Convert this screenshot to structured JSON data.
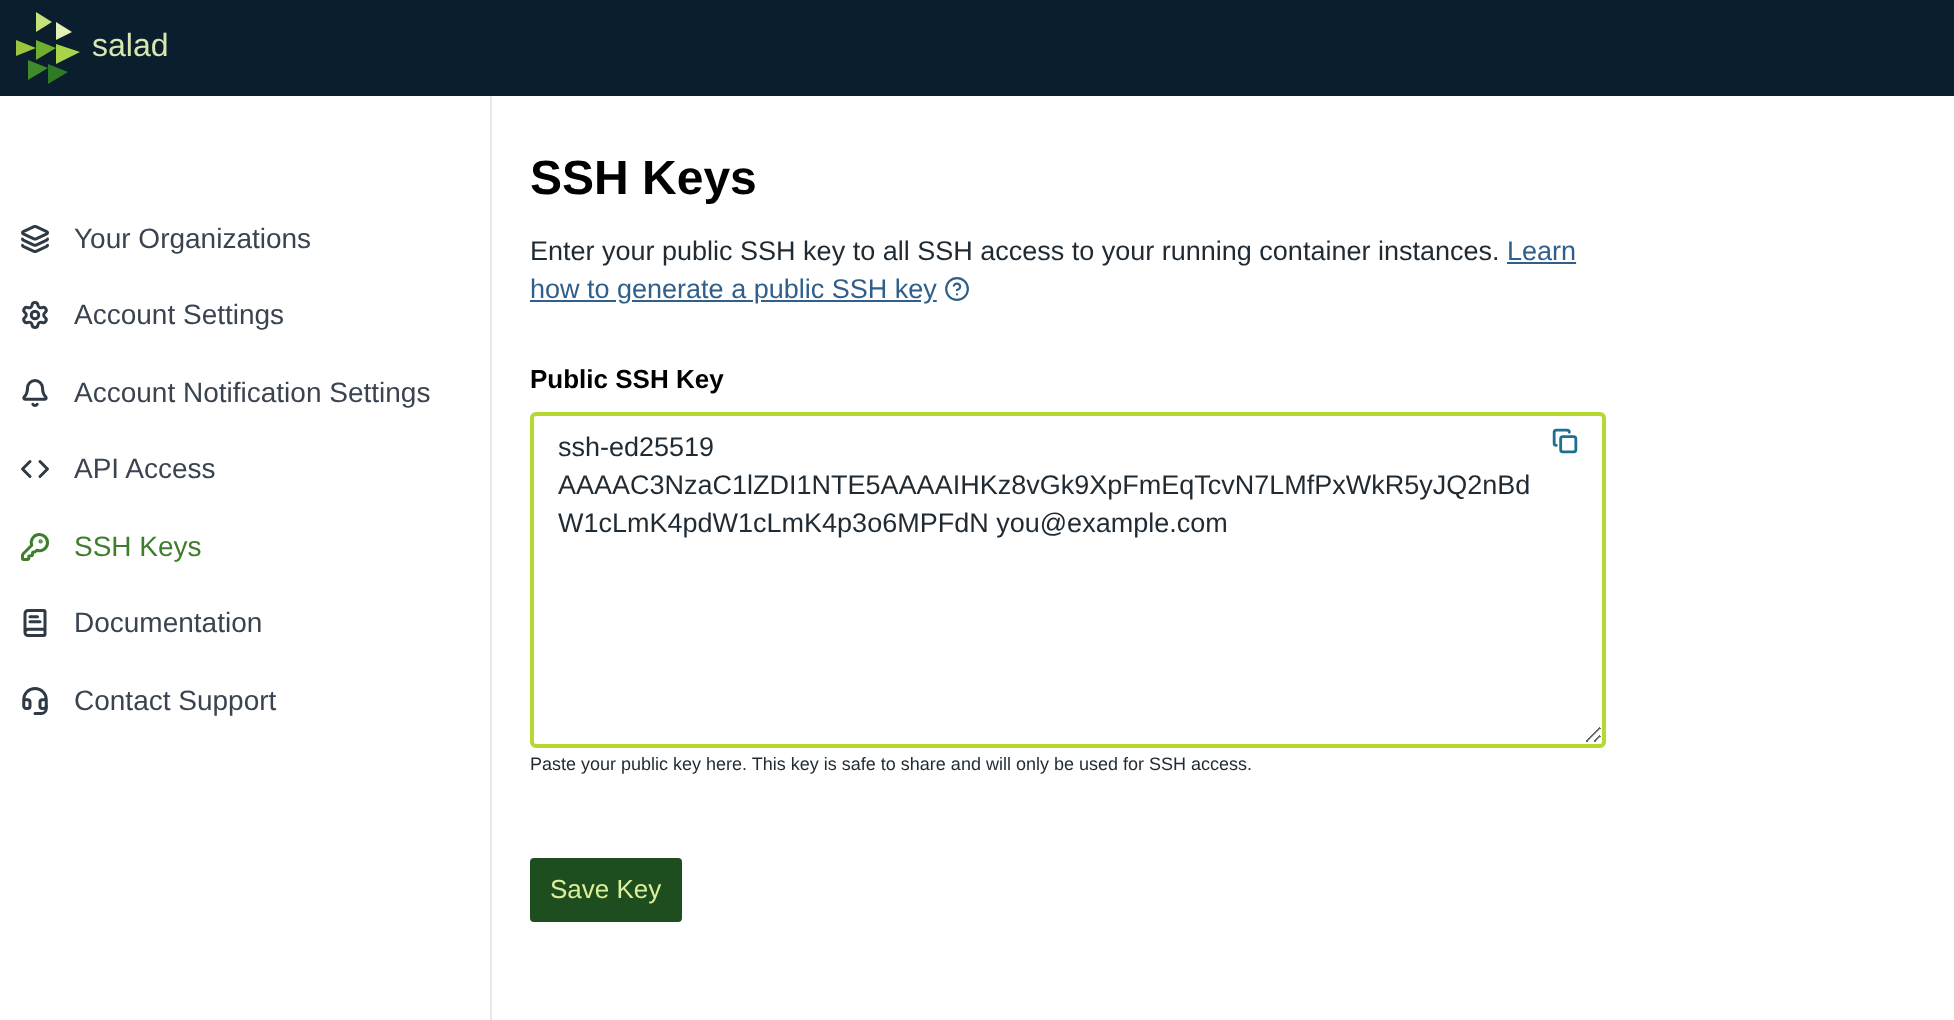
{
  "header": {
    "brand": "salad"
  },
  "sidebar": {
    "items": [
      {
        "label": "Your Organizations",
        "selected": false
      },
      {
        "label": "Account Settings",
        "selected": false
      },
      {
        "label": "Account Notification Settings",
        "selected": false
      },
      {
        "label": "API Access",
        "selected": false
      },
      {
        "label": "SSH Keys",
        "selected": true
      },
      {
        "label": "Documentation",
        "selected": false
      },
      {
        "label": "Contact Support",
        "selected": false
      }
    ]
  },
  "page": {
    "title": "SSH Keys",
    "description": "Enter your public SSH key to all SSH access to your running container instances.",
    "link_lines": [
      "Learn",
      "how to generate a public SSH key"
    ],
    "field": {
      "label": "Public SSH Key",
      "value": "ssh-ed25519\nAAAAC3NzaC1lZDI1NTE5AAAAIHKz8vGk9XpFmEqTcvN7LMfPxWkR5yJQ2nBdW1cLmK4pdW1cLmK4p3o6MPFdN you@example.com",
      "help": "Paste your public key here. This key is safe to share and will only be used for SSH access."
    },
    "button": "Save Key"
  }
}
